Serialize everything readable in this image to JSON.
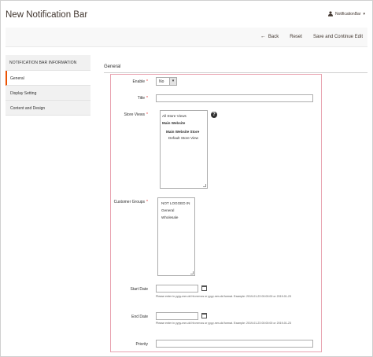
{
  "header": {
    "title": "New Notification Bar",
    "user_name": "NotificationBar",
    "user_caret": "▾"
  },
  "actions": {
    "back_label": "Back",
    "back_arrow": "←",
    "reset_label": "Reset",
    "save_label": "Save and Continue Edit"
  },
  "sidebar": {
    "header": "NOTIFICATION BAR INFORMATION",
    "items": [
      {
        "label": "General",
        "active": true
      },
      {
        "label": "Display Setting",
        "active": false
      },
      {
        "label": "Content and Design",
        "active": false
      }
    ]
  },
  "main": {
    "section_title": "General",
    "fields": {
      "enable": {
        "label": "Enable",
        "required": "*",
        "value": "No",
        "arrow": "▾"
      },
      "title": {
        "label": "Title",
        "required": "*",
        "value": ""
      },
      "store_views": {
        "label": "Store Views",
        "required": "*",
        "help": "?",
        "options": [
          "All Store Views",
          "Main Website",
          "Main Website Store",
          "Default Store View"
        ]
      },
      "customer_groups": {
        "label": "Customer Groups",
        "required": "*",
        "options": [
          "NOT LOGGED IN",
          "General",
          "Wholesale"
        ]
      },
      "start_date": {
        "label": "Start Date",
        "value": "",
        "note": "Please enter in yyyy-mm-dd hh:mm:ss or yyyy-mm-dd format. Example: 2019-01-23 00:00:00 or 2019-01-23"
      },
      "end_date": {
        "label": "End Date",
        "value": "",
        "note": "Please enter in yyyy-mm-dd hh:mm:ss or yyyy-mm-dd format. Example: 2019-01-23 00:00:00 or 2019-01-23"
      },
      "priority": {
        "label": "Priority",
        "value": ""
      }
    }
  },
  "colors": {
    "accent": "#eb5202",
    "required": "#e22626",
    "highlight_border": "#e8a3b0"
  }
}
